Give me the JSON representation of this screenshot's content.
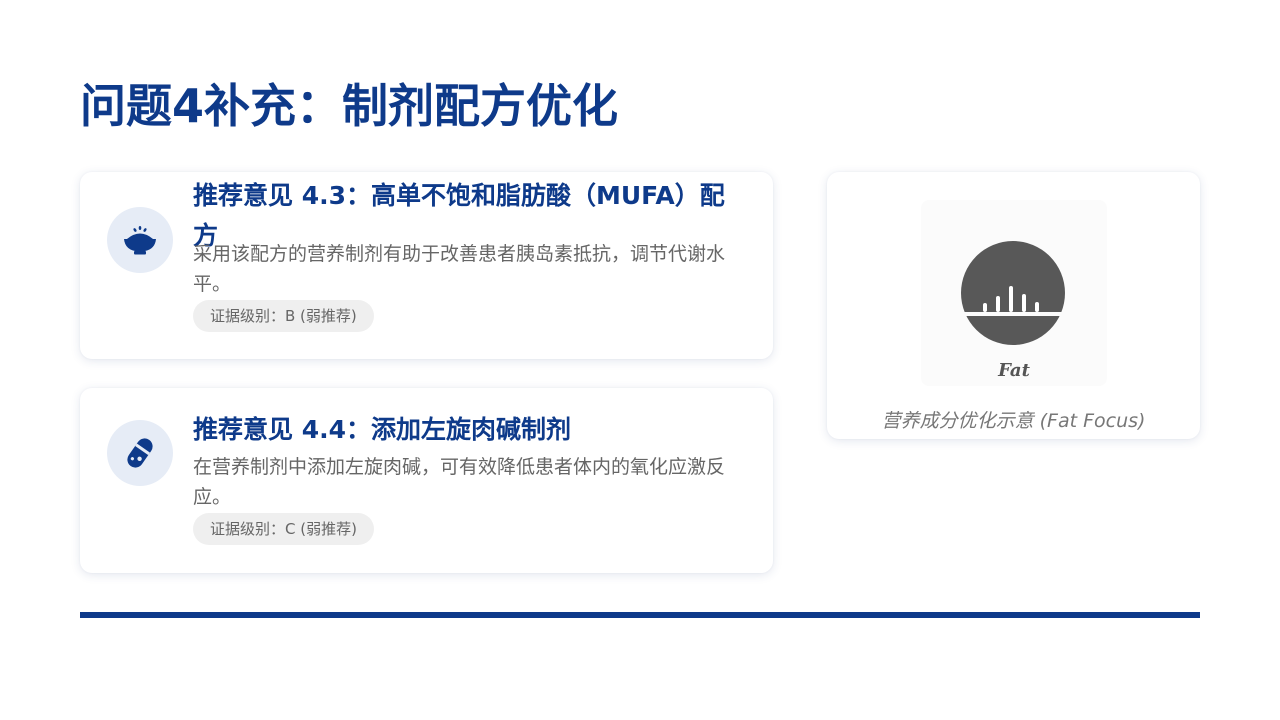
{
  "title": "问题4补充：制剂配方优化",
  "recommendations": [
    {
      "title": "推荐意见 4.3：高单不饱和脂肪酸（MUFA）配方",
      "description": "采用该配方的营养制剂有助于改善患者胰岛素抵抗，调节代谢水平。",
      "evidence": "证据级别：B (弱推荐)",
      "icon": "rice-bowl-icon"
    },
    {
      "title": "推荐意见 4.4：添加左旋肉碱制剂",
      "description": "在营养制剂中添加左旋肉碱，可有效降低患者体内的氧化应激反应。",
      "evidence": "证据级别：C (弱推荐)",
      "icon": "pill-capsule-icon"
    }
  ],
  "image_panel": {
    "icon": "fat-icon",
    "icon_label": "Fat",
    "caption": "营养成分优化示意 (Fat Focus)"
  },
  "colors": {
    "primary": "#0e3a8a",
    "icon_bg": "#e6ecf6",
    "badge_bg": "#efefef",
    "text_muted": "#666666",
    "fat_icon": "#585858"
  }
}
